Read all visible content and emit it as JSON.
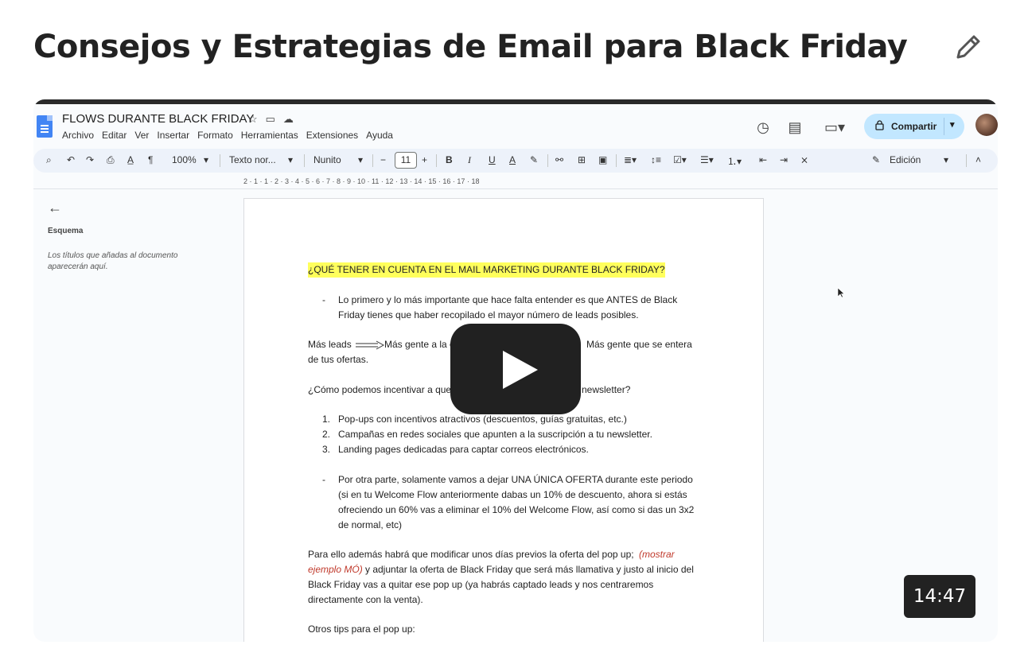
{
  "title": "Consejos y Estrategias de Email para Black Friday",
  "edit_icon": "pencil-icon",
  "video": {
    "duration": "14:47",
    "play_icon": "play-icon",
    "doc": {
      "title": "FLOWS DURANTE BLACK FRIDAY",
      "menu": [
        "Archivo",
        "Editar",
        "Ver",
        "Insertar",
        "Formato",
        "Herramientas",
        "Extensiones",
        "Ayuda"
      ],
      "share_label": "Compartir",
      "toolbar": {
        "zoom": "100%",
        "style": "Texto nor...",
        "font": "Nunito",
        "font_size": "11",
        "mode": "Edición"
      },
      "ruler": "2 · 1 · 1 · 2 · 3 · 4 · 5 · 6 · 7 · 8 · 9 · 10 · 11 · 12 · 13 · 14 · 15 · 16 · 17 · 18",
      "outline": {
        "title": "Esquema",
        "hint": "Los títulos que añadas al documento aparecerán aquí."
      },
      "content": {
        "heading": "¿QUÉ TENER EN CUENTA EN EL MAIL MARKETING DURANTE BLACK FRIDAY?",
        "bullet1_a": "Lo primero y lo más importante que hace falta entender es que ANTES de Black",
        "bullet1_b": "Friday tienes que haber recopilado el mayor número de leads posibles.",
        "flow_a": "Más leads",
        "flow_b": "Más gente a la c",
        "flow_c": "Más gente que se entera",
        "flow_d": "de tus ofertas.",
        "question_a": "¿Cómo podemos incentivar a que",
        "question_b": "newsletter?",
        "list": [
          "Pop-ups con incentivos atractivos (descuentos, guías gratuitas, etc.)",
          "Campañas en redes sociales que apunten a la suscripción a tu newsletter.",
          "Landing pages dedicadas para captar correos electrónicos."
        ],
        "bullet2": [
          "Por otra parte, solamente vamos a dejar UNA ÚNICA OFERTA durante este periodo",
          "(si en tu Welcome Flow anteriormente dabas un 10% de descuento, ahora si estás",
          "ofreciendo un 60% vas a eliminar el 10% del Welcome Flow, así como si das un 3x2",
          "de normal, etc)"
        ],
        "para_a": "Para ello además habrá que modificar unos días previos la oferta del pop up;",
        "para_red_a": "(mostrar",
        "para_red_b": "ejemplo MÓ)",
        "para_b": "y adjuntar la oferta de Black Friday que será más llamativa y justo al inicio del",
        "para_c": "Black Friday vas a quitar ese pop up (ya habrás captado leads y nos centraremos",
        "para_d": "directamente con la venta).",
        "tips": "Otros tips para el pop up:"
      }
    }
  }
}
